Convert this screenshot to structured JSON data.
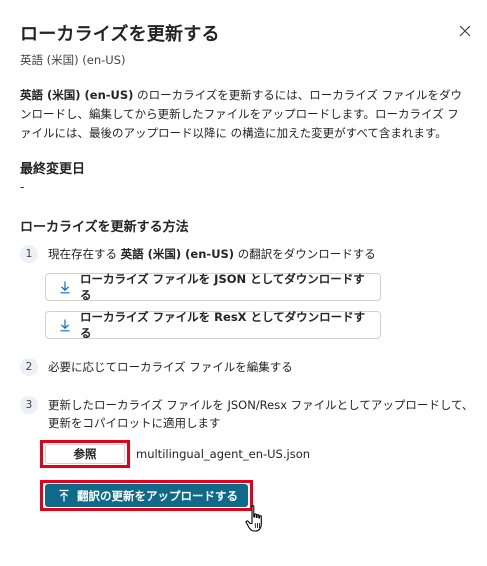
{
  "dialog": {
    "title": "ローカライズを更新する",
    "close_icon": "close-icon",
    "subtitle": "英語 (米国) (en-US)",
    "description_bold": "英語 (米国) (en-US)",
    "description_rest": " のローカライズを更新するには、ローカライズ ファイルをダウンロードし、編集してから更新したファイルをアップロードします。ローカライズ ファイルには、最後のアップロード以降に の構造に加えた変更がすべて含まれます。"
  },
  "last_modified": {
    "label": "最終変更日",
    "value": "-"
  },
  "how_to": {
    "heading": "ローカライズを更新する方法",
    "steps": [
      {
        "number": "1",
        "text_before": "現在存在する ",
        "text_bold": "英語 (米国) (en-US)",
        "text_after": " の翻訳をダウンロードする"
      },
      {
        "number": "2",
        "text": "必要に応じてローカライズ ファイルを編集する"
      },
      {
        "number": "3",
        "text": "更新したローカライズ ファイルを JSON/Resx ファイルとしてアップロードして、更新をコパイロットに適用します"
      }
    ],
    "download_json_label": "ローカライズ ファイルを JSON としてダウンロードする",
    "download_resx_label": "ローカライズ ファイルを ResX としてダウンロードする",
    "download_icon": "download-arrow-icon",
    "browse_label": "参照",
    "selected_file": "multilingual_agent_en-US.json",
    "upload_label": "翻訳の更新をアップロードする",
    "upload_icon": "upload-arrow-icon"
  },
  "colors": {
    "upload_button_bg": "#0f6a8a",
    "highlight_border": "#e3001b",
    "step_badge_bg": "#ebf1f7"
  }
}
